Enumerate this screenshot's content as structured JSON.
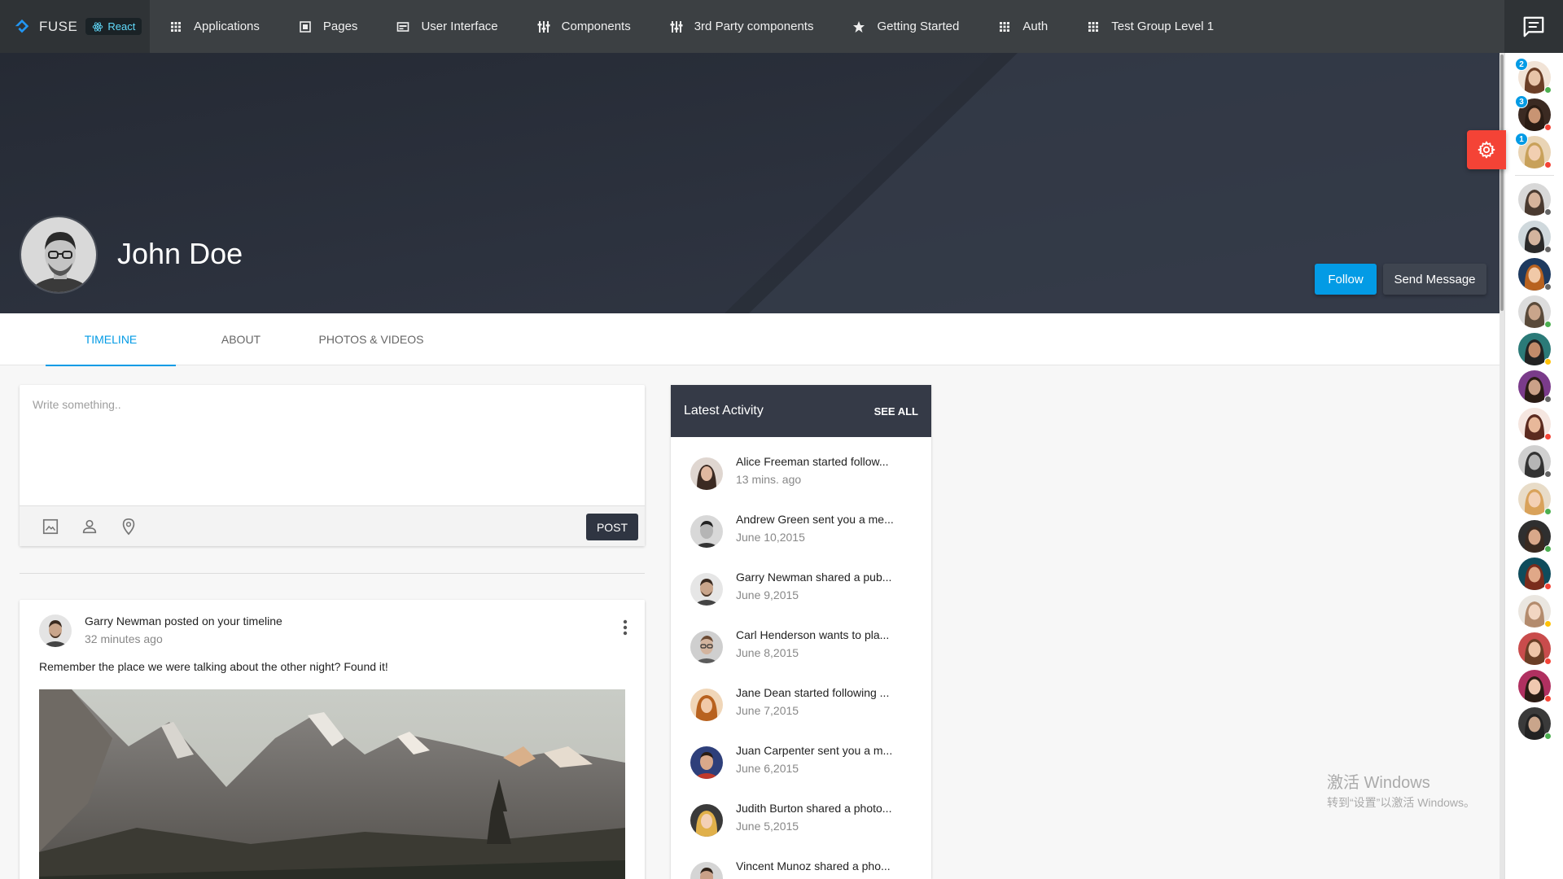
{
  "brand": {
    "name": "FUSE",
    "framework": "React"
  },
  "nav": [
    {
      "label": "Applications",
      "icon": "apps-grid-icon"
    },
    {
      "label": "Pages",
      "icon": "pages-icon"
    },
    {
      "label": "User Interface",
      "icon": "web-icon"
    },
    {
      "label": "Components",
      "icon": "components-icon"
    },
    {
      "label": "3rd Party components",
      "icon": "components-icon"
    },
    {
      "label": "Getting Started",
      "icon": "star-icon"
    },
    {
      "label": "Auth",
      "icon": "apps-grid-icon"
    },
    {
      "label": "Test Group Level 1",
      "icon": "apps-grid-icon"
    }
  ],
  "profile": {
    "name": "John Doe",
    "follow_label": "Follow",
    "message_label": "Send Message"
  },
  "tabs": [
    {
      "label": "Timeline",
      "active": true
    },
    {
      "label": "About",
      "active": false
    },
    {
      "label": "Photos & Videos",
      "active": false
    }
  ],
  "composer": {
    "placeholder": "Write something..",
    "post_label": "Post",
    "tools": [
      "photo-icon",
      "person-icon",
      "location-pin-icon"
    ]
  },
  "post": {
    "author_line": "Garry Newman posted on your timeline",
    "time": "32 minutes ago",
    "message": "Remember the place we were talking about the other night? Found it!"
  },
  "activity": {
    "title": "Latest Activity",
    "see_all": "See All",
    "items": [
      {
        "message": "Alice Freeman started follow...",
        "time": "13 mins. ago"
      },
      {
        "message": "Andrew Green sent you a me...",
        "time": "June 10,2015"
      },
      {
        "message": "Garry Newman shared a pub...",
        "time": "June 9,2015"
      },
      {
        "message": "Carl Henderson wants to pla...",
        "time": "June 8,2015"
      },
      {
        "message": "Jane Dean started following ...",
        "time": "June 7,2015"
      },
      {
        "message": "Juan Carpenter sent you a m...",
        "time": "June 6,2015"
      },
      {
        "message": "Judith Burton shared a photo...",
        "time": "June 5,2015"
      },
      {
        "message": "Vincent Munoz shared a pho...",
        "time": ""
      }
    ]
  },
  "contacts": [
    {
      "unread": "2",
      "status": "online"
    },
    {
      "unread": "3",
      "status": "busy"
    },
    {
      "unread": "1",
      "status": "busy"
    },
    {
      "unread": "",
      "status": "offline"
    },
    {
      "unread": "",
      "status": "offline"
    },
    {
      "unread": "",
      "status": "offline"
    },
    {
      "unread": "",
      "status": "online"
    },
    {
      "unread": "",
      "status": "away"
    },
    {
      "unread": "",
      "status": "offline"
    },
    {
      "unread": "",
      "status": "busy"
    },
    {
      "unread": "",
      "status": "offline"
    },
    {
      "unread": "",
      "status": "online"
    },
    {
      "unread": "",
      "status": "online"
    },
    {
      "unread": "",
      "status": "busy"
    },
    {
      "unread": "",
      "status": "away"
    },
    {
      "unread": "",
      "status": "busy"
    },
    {
      "unread": "",
      "status": "busy"
    },
    {
      "unread": "",
      "status": "online"
    }
  ],
  "colors": {
    "accent": "#039be5",
    "nav_bg": "#3c4043",
    "header_bg": "#2b303b",
    "settings_fab": "#f44336",
    "status_online": "#4caf50",
    "status_busy": "#f44336",
    "status_away": "#ffc107",
    "status_offline": "#646464"
  },
  "watermark": {
    "line1": "激活 Windows",
    "line2": "转到“设置”以激活 Windows。"
  }
}
